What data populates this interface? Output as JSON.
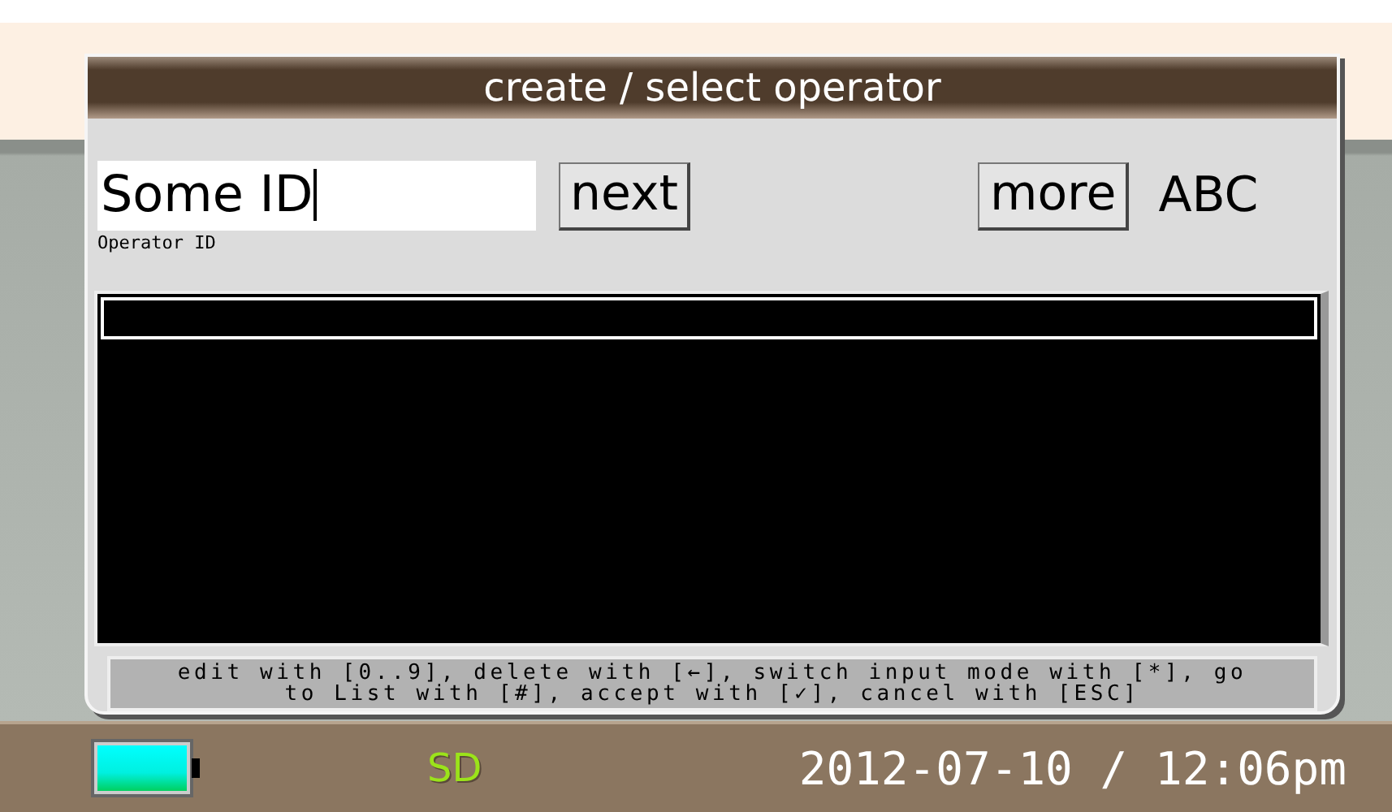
{
  "dialog": {
    "title": "create / select operator",
    "input": {
      "value": "Some ID",
      "label": "Operator ID"
    },
    "buttons": [
      {
        "label": "next",
        "kind": "next"
      },
      {
        "label": "more",
        "kind": "more"
      }
    ],
    "input_mode": "ABC",
    "help": "edit with [0..9], delete with [←], switch input mode with [*], go to List with [#], accept with [✓], cancel with [ESC]"
  },
  "status_bar": {
    "storage": "SD",
    "datetime": "2012-07-10 / 12:06pm"
  }
}
